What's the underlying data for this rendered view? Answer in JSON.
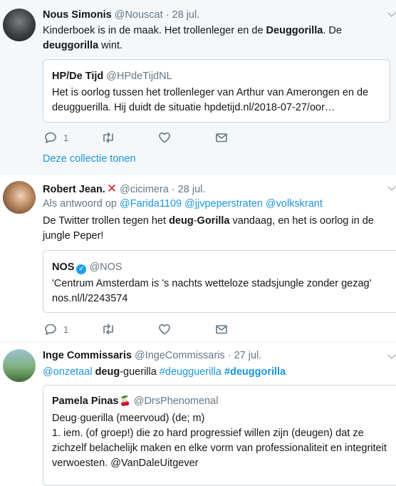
{
  "tweets": [
    {
      "name": "Nous Simonis",
      "handle": "@Nouscat",
      "date": "28 jul.",
      "text": {
        "p1": "Kinderboek is in de maak. Het trollenleger en de ",
        "b1": "Deuggorilla",
        "p2": ". De ",
        "b2": "deuggorilla",
        "p3": " wint."
      },
      "quote": {
        "name": "HP/De Tijd",
        "handle": "@HPdeTijdNL",
        "text": "Het is oorlog tussen het trollenleger van Arthur van Amerongen en de deugguerilla. Hij duidt de situatie hpdetijd.nl/2018-07-27/oor…"
      },
      "reply_count": "1",
      "collection_link": "Deze collectie tonen"
    },
    {
      "name": "Robert Jean.",
      "handle": "@cicimera",
      "date": "28 jul.",
      "reply_to": {
        "prefix": "Als antwoord op",
        "mention1": "@Farida1109",
        "mention2": "@jjvpeperstraten",
        "mention3": "@volkskrant"
      },
      "text": {
        "p1": "De Twitter trollen tegen het ",
        "b1": "deug",
        "p2": "-",
        "b2": "Gorilla",
        "p3": " vandaag, en het is oorlog in de jungle Peper!"
      },
      "quote": {
        "name": "NOS",
        "handle": "@NOS",
        "line1": "'Centrum Amsterdam is 's nachts wetteloze stadsjungle zonder gezag'",
        "line2": "nos.nl/l/2243574"
      },
      "reply_count": "1"
    },
    {
      "name": "Inge Commissaris",
      "handle": "@IngeCommissaris",
      "date": "27 jul.",
      "text": {
        "mention": "@onzetaal",
        "b1": "deug",
        "p1": "-guerilla ",
        "tag1": "#deugguerilla",
        "tag2": "#deuggorilla"
      },
      "quote": {
        "name": "Pamela Pinas",
        "handle": "@DrsPhenomenal",
        "line1": "Deug·guerilla (meervoud) (de; m)",
        "line2": "1. iem. (of groep!) die zo hard progressief willen zijn (deugen) dat ze zichzelf belachelijk maken en elke vorm van professionaliteit en integriteit verwoesten. @VanDaleUitgever"
      }
    }
  ],
  "separators": {
    "dot": "·"
  },
  "symbols": {
    "cross": "✕",
    "cherry": "🍒",
    "check": "✓"
  },
  "colors": {
    "link": "#1b95e0",
    "muted": "#657786",
    "verified": "#1da1f2"
  }
}
